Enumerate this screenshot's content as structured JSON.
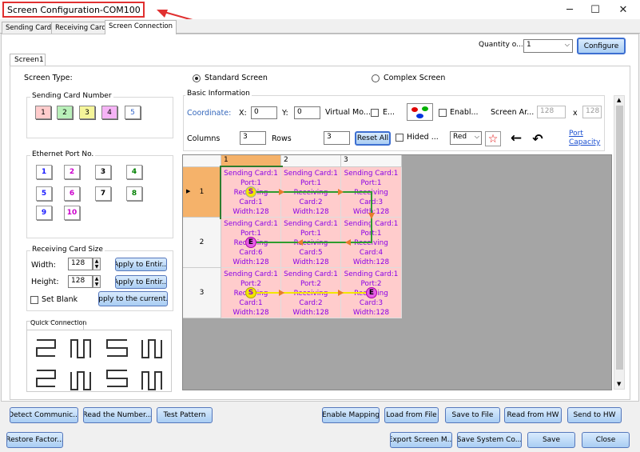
{
  "window": {
    "title": "Screen Configuration-COM100",
    "minimize": "─",
    "maximize": "☐",
    "close": "✕"
  },
  "tabs": [
    {
      "label": "Sending Card"
    },
    {
      "label": "Receiving Card"
    },
    {
      "label": "Screen Connection"
    }
  ],
  "quantity": {
    "label": "Quantity o...",
    "value": "1",
    "configure": "Configure"
  },
  "screen_tab": "Screen1",
  "screen_type": {
    "label": "Screen Type:",
    "standard": "Standard Screen",
    "complex": "Complex Screen"
  },
  "sending_card_number": {
    "title": "Sending Card Number",
    "items": [
      "1",
      "2",
      "3",
      "4",
      "5"
    ],
    "colors": [
      "#ffcccc",
      "#b9f0b9",
      "#f5f59a",
      "#f5b3f5",
      "#ffffff"
    ]
  },
  "ethernet_port": {
    "title": "Ethernet Port No.",
    "items": [
      "1",
      "2",
      "3",
      "4",
      "5",
      "6",
      "7",
      "8",
      "9",
      "10"
    ],
    "colors": [
      "#1a1aff",
      "#cc00cc",
      "#000000",
      "#008000",
      "#1a1aff",
      "#cc00cc",
      "#000000",
      "#008000",
      "#1a1aff",
      "#cc00cc"
    ]
  },
  "receiving_card_size": {
    "title": "Receiving Card Size",
    "width_label": "Width:",
    "width": "128",
    "height_label": "Height:",
    "height": "128",
    "apply_width": "Apply to Entir...",
    "apply_height": "Apply to Entir...",
    "set_blank": "Set Blank",
    "apply_current": "Apply to the current..."
  },
  "quick_connection": {
    "title": "Quick Connection"
  },
  "basic_info": {
    "title": "Basic Information",
    "coordinate": "Coordinate:",
    "x_label": "X:",
    "x": "0",
    "y_label": "Y:",
    "y": "0",
    "virtual": "Virtual Mo...",
    "virtual_e": "E...",
    "enable": "Enabl...",
    "screen_area": "Screen Ar...",
    "area_w": "128",
    "area_x": "x",
    "area_h": "128",
    "columns_label": "Columns",
    "columns": "3",
    "rows_label": "Rows",
    "rows": "3",
    "reset": "Reset All",
    "hide": "Hided ...",
    "color_value": "Red",
    "port_capacity": "Port Capacity"
  },
  "grid": {
    "col_headers": [
      "1",
      "2",
      "3"
    ],
    "row_headers": [
      "1",
      "2",
      "3"
    ],
    "cells": [
      [
        [
          "Sending Card:1",
          "Port:1",
          "Receiving",
          "Card:1",
          "Width:128"
        ],
        [
          "Sending Card:1",
          "Port:1",
          "Receiving",
          "Card:2",
          "Width:128"
        ],
        [
          "Sending Card:1",
          "Port:1",
          "Receiving",
          "Card:3",
          "Width:128"
        ]
      ],
      [
        [
          "Sending Card:1",
          "Port:1",
          "Receiving",
          "Card:6",
          "Width:128"
        ],
        [
          "Sending Card:1",
          "Port:1",
          "Receiving",
          "Card:5",
          "Width:128"
        ],
        [
          "Sending Card:1",
          "Port:1",
          "Receiving",
          "Card:4",
          "Width:128"
        ]
      ],
      [
        [
          "Sending Card:1",
          "Port:2",
          "Receiving",
          "Card:1",
          "Width:128"
        ],
        [
          "Sending Card:1",
          "Port:2",
          "Receiving",
          "Card:2",
          "Width:128"
        ],
        [
          "Sending Card:1",
          "Port:2",
          "Receiving",
          "Card:3",
          "Width:128"
        ]
      ]
    ],
    "marker_start": "S",
    "marker_end": "E"
  },
  "bottom_row1": {
    "detect": "Detect Communic...",
    "read_number": "Read the Number...",
    "test_pattern": "Test Pattern",
    "enable_mapping": "Enable Mapping",
    "load_file": "Load from File",
    "save_file": "Save to File",
    "read_hw": "Read from HW",
    "send_hw": "Send to HW"
  },
  "bottom_row2": {
    "restore": "Restore Factor...",
    "export": "Export Screen M...",
    "save_system": "Save System Co...",
    "save": "Save",
    "close": "Close"
  },
  "colors": {
    "accent_red": "#e03030",
    "cell_bg": "#ffcccc",
    "cell_text": "#8a00e6",
    "path_green": "#2e9d2e",
    "path_yellow": "#f2e600",
    "selected_row": "#f5b26a"
  }
}
